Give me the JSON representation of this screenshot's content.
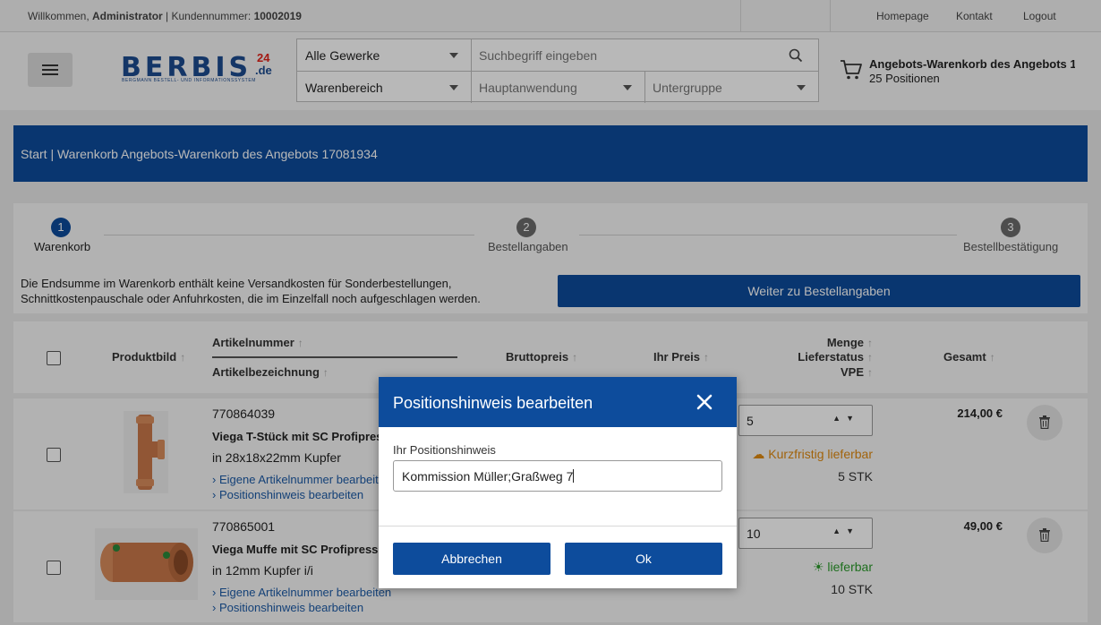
{
  "topbar": {
    "welcome_prefix": "Willkommen,",
    "user": "Administrator",
    "customer_label": "| Kundennummer:",
    "customer_number": "10002019",
    "links": [
      "Homepage",
      "Kontakt",
      "Logout"
    ]
  },
  "header": {
    "logo": {
      "main": "BERBIS",
      "suffix_num": "24",
      "suffix_tld": ".de",
      "tagline": "BERGMANN BESTELL- UND INFORMATIONSSYSTEM"
    },
    "search": {
      "trade_select": "Alle Gewerke",
      "search_placeholder": "Suchbegriff eingeben",
      "area_select": "Warenbereich",
      "main_app_select": "Hauptanwendung",
      "subgroup_select": "Untergruppe"
    },
    "cart": {
      "title": "Angebots-Warenkorb des Angebots 17081934",
      "count": "25 Positionen"
    }
  },
  "breadcrumb": {
    "text": "Start | Warenkorb Angebots-Warenkorb des Angebots 17081934"
  },
  "steps": [
    {
      "num": "1",
      "label": "Warenkorb",
      "active": true
    },
    {
      "num": "2",
      "label": "Bestellangaben",
      "active": false
    },
    {
      "num": "3",
      "label": "Bestellbestätigung",
      "active": false
    }
  ],
  "info": {
    "line1": "Die Endsumme im Warenkorb enthält keine Versandkosten für Sonderbestellungen,",
    "line2": "Schnittkostenpauschale oder Anfuhrkosten, die im Einzelfall noch aufgeschlagen werden.",
    "next_button": "Weiter zu Bestellangaben"
  },
  "table": {
    "headers": {
      "image": "Produktbild",
      "article_number": "Artikelnummer",
      "article_name": "Artikelbezeichnung",
      "gross_price": "Bruttopreis",
      "your_price": "Ihr Preis",
      "quantity": "Menge",
      "delivery_status": "Lieferstatus",
      "vpe": "VPE",
      "total": "Gesamt"
    },
    "rows": [
      {
        "article_number": "770864039",
        "name": "Viega T-Stück mit SC Profipress",
        "spec": "in 28x18x22mm Kupfer",
        "link1": "› Eigene Artikelnummer bearbeiten",
        "link2": "› Positionshinweis bearbeiten",
        "quantity": "5",
        "availability": "Kurzfristig lieferbar",
        "availability_color": "#e08a10",
        "vpe": "5 STK",
        "total": "214,00 €"
      },
      {
        "article_number": "770865001",
        "name": "Viega Muffe mit SC Profipress",
        "spec": "in 12mm Kupfer i/i",
        "link1": "› Eigene Artikelnummer bearbeiten",
        "link2": "› Positionshinweis bearbeiten",
        "quantity": "10",
        "availability": "lieferbar",
        "availability_color": "#2a9a2a",
        "vpe": "10 STK",
        "total": "49,00 €"
      }
    ]
  },
  "modal": {
    "title": "Positionshinweis bearbeiten",
    "label": "Ihr Positionshinweis",
    "input_value": "Kommission Müller;Graßweg 7",
    "cancel": "Abbrechen",
    "ok": "Ok"
  },
  "colors": {
    "primary": "#0d4c9c",
    "link": "#1c5aa6"
  }
}
